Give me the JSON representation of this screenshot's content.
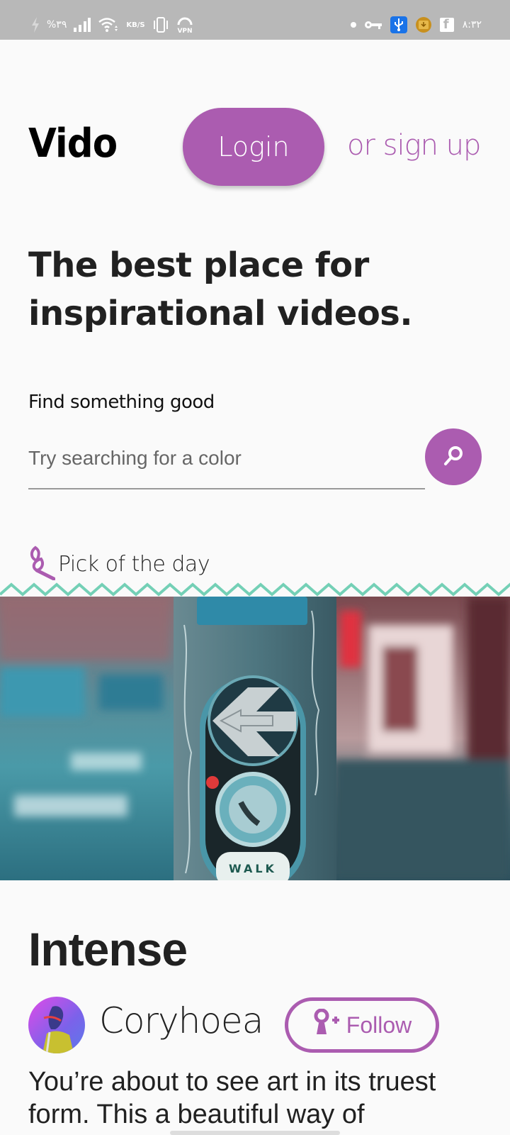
{
  "status_bar": {
    "battery_text": "%۳۹",
    "network_speed_unit": "KB/S",
    "vpn_label": "VPN",
    "time": "۸:۳۲",
    "icons": [
      "charging-bolt-icon",
      "signal-bars-icon",
      "wifi-icon",
      "vibrate-icon",
      "vpn-icon",
      "notification-dot-icon",
      "key-icon",
      "usb-icon",
      "download-icon",
      "facebook-icon"
    ]
  },
  "header": {
    "logo": "Vido",
    "login_label": "Login",
    "signup_label": "or sign up"
  },
  "hero": {
    "title": "The best place for inspirational videos."
  },
  "search": {
    "label": "Find something good",
    "placeholder": "Try searching for a color",
    "value": "",
    "button_icon": "search-icon"
  },
  "pick_of_day": {
    "label": "Pick of the day",
    "icon": "leaf-sprig-icon",
    "image_alt": "Pedestrian crossing button with left arrow on a street pole",
    "image_caption_text": "WALK WITH"
  },
  "video": {
    "title": "Intense",
    "author": "Coryhoea",
    "follow_label": "Follow",
    "description": "You’re about to see art in its truest form. This a beautiful way of"
  },
  "colors": {
    "accent": "#ab5cb0",
    "zigzag": "#74d0b6",
    "status_bar": "#b8b8b8",
    "background": "#fafafa"
  }
}
